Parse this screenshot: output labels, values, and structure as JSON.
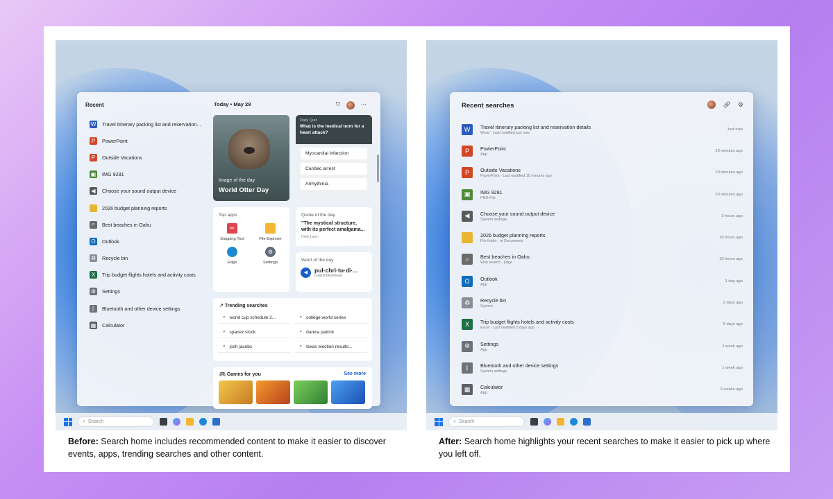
{
  "before": {
    "caption_bold": "Before:",
    "caption_text": " Search home includes recommended content to make it easier to discover events, apps, trending searches and other content.",
    "recent_title": "Recent",
    "today_label": "Today",
    "date_label": "May 29",
    "recent_items": [
      {
        "label": "Travel itinerary packing list and reservation...",
        "icon": "word-icon",
        "color": "#2b5bbd"
      },
      {
        "label": "PowerPoint",
        "icon": "powerpoint-icon",
        "color": "#d24726"
      },
      {
        "label": "Outside Vacations",
        "icon": "powerpoint-icon",
        "color": "#d24726"
      },
      {
        "label": "IMG 9281",
        "icon": "image-icon",
        "color": "#4f8a3a"
      },
      {
        "label": "Choose your sound output device",
        "icon": "speaker-icon",
        "color": "#5a5a5a"
      },
      {
        "label": "2026 budget planning reports",
        "icon": "folder-icon",
        "color": "#e8b632"
      },
      {
        "label": "Best beaches in Oahu",
        "icon": "search-icon",
        "color": "#6a6a6a"
      },
      {
        "label": "Outlook",
        "icon": "outlook-icon",
        "color": "#0f6cbd"
      },
      {
        "label": "Recycle bin",
        "icon": "recycle-bin-icon",
        "color": "#8a8f96"
      },
      {
        "label": "Trip budget flights hotels and activity costs",
        "icon": "excel-icon",
        "color": "#1d7044"
      },
      {
        "label": "Settings",
        "icon": "gear-icon",
        "color": "#6d7178"
      },
      {
        "label": "Bluetooth and other device settings",
        "icon": "bluetooth-icon",
        "color": "#6d7178"
      },
      {
        "label": "Calculator",
        "icon": "calculator-icon",
        "color": "#5c6066"
      }
    ],
    "image_of_day": {
      "label": "Image of the day",
      "title": "World Otter Day"
    },
    "quiz": {
      "label": "Daily Quiz",
      "question": "What is the medical term for a heart attack?",
      "options": [
        "Myocardial infarction",
        "Cardiac arrest",
        "Arrhythmia"
      ]
    },
    "top_apps": {
      "label": "Top apps",
      "apps": [
        {
          "label": "Snipping Tool",
          "color": "#e0454f"
        },
        {
          "label": "File Explorer",
          "color": "#f2b632"
        },
        {
          "label": "Edge",
          "color": "#1b8ad3"
        },
        {
          "label": "Settings",
          "color": "#5e6b78"
        }
      ]
    },
    "quote": {
      "label": "Quote of the day",
      "text": "\"The mystical structure, with its perfect amalgama...",
      "author": "Hello Lawn"
    },
    "word": {
      "label": "Word of the day",
      "word": "pul·chri·tu·di·...",
      "sub": "Lowkid blockhead"
    },
    "trending": {
      "label": "Trending searches",
      "items": [
        "world cup schedule 2...",
        "college world series",
        "spacex stock",
        "danica patrick",
        "josh jacobs",
        "texas election results..."
      ]
    },
    "games": {
      "label": "Games for you",
      "more": "See more"
    },
    "taskbar_search": "Search"
  },
  "after": {
    "caption_bold": "After:",
    "caption_text": " Search home highlights your recent searches to make it easier to pick up where you left off.",
    "title": "Recent searches",
    "items": [
      {
        "name": "Travel itinerary packing list and reservation details",
        "sub": "Word · Last modified just now",
        "time": "Just now",
        "icon": "word-icon",
        "color": "#2b5bbd"
      },
      {
        "name": "PowerPoint",
        "sub": "App",
        "time": "10 minutes ago",
        "icon": "powerpoint-icon",
        "color": "#d24726"
      },
      {
        "name": "Outside Vacations",
        "sub": "PowerPoint · Last modified 10 minutes ago",
        "time": "10 minutes ago",
        "icon": "powerpoint-icon",
        "color": "#d24726"
      },
      {
        "name": "IMG 9281",
        "sub": "PNG File",
        "time": "20 minutes ago",
        "icon": "image-icon",
        "color": "#4f8a3a"
      },
      {
        "name": "Choose your sound output device",
        "sub": "System settings",
        "time": "3 hours ago",
        "icon": "speaker-icon",
        "color": "#5a5a5a"
      },
      {
        "name": "2026 budget planning reports",
        "sub": "File folder · in Documents",
        "time": "10 hours ago",
        "icon": "folder-icon",
        "color": "#e8b632"
      },
      {
        "name": "Best beaches in Oahu",
        "sub": "Web search · Edge",
        "time": "10 hours ago",
        "icon": "search-icon",
        "color": "#6a6a6a"
      },
      {
        "name": "Outlook",
        "sub": "App",
        "time": "1 day ago",
        "icon": "outlook-icon",
        "color": "#0f6cbd"
      },
      {
        "name": "Recycle bin",
        "sub": "System",
        "time": "2 days ago",
        "icon": "recycle-bin-icon",
        "color": "#8a8f96"
      },
      {
        "name": "Trip budget flights hotels and activity costs",
        "sub": "Excel · Last modified 5 days ago",
        "time": "5 days ago",
        "icon": "excel-icon",
        "color": "#1d7044"
      },
      {
        "name": "Settings",
        "sub": "App",
        "time": "1 week ago",
        "icon": "gear-icon",
        "color": "#6d7178"
      },
      {
        "name": "Bluetooth and other device settings",
        "sub": "System settings",
        "time": "1 week ago",
        "icon": "bluetooth-icon",
        "color": "#6d7178"
      },
      {
        "name": "Calculator",
        "sub": "App",
        "time": "2 weeks ago",
        "icon": "calculator-icon",
        "color": "#5c6066"
      }
    ],
    "taskbar_search": "Search"
  },
  "colors": {
    "page_bg": "#c890f4",
    "accent": "#1a5fc8",
    "card": "#ffffff"
  }
}
